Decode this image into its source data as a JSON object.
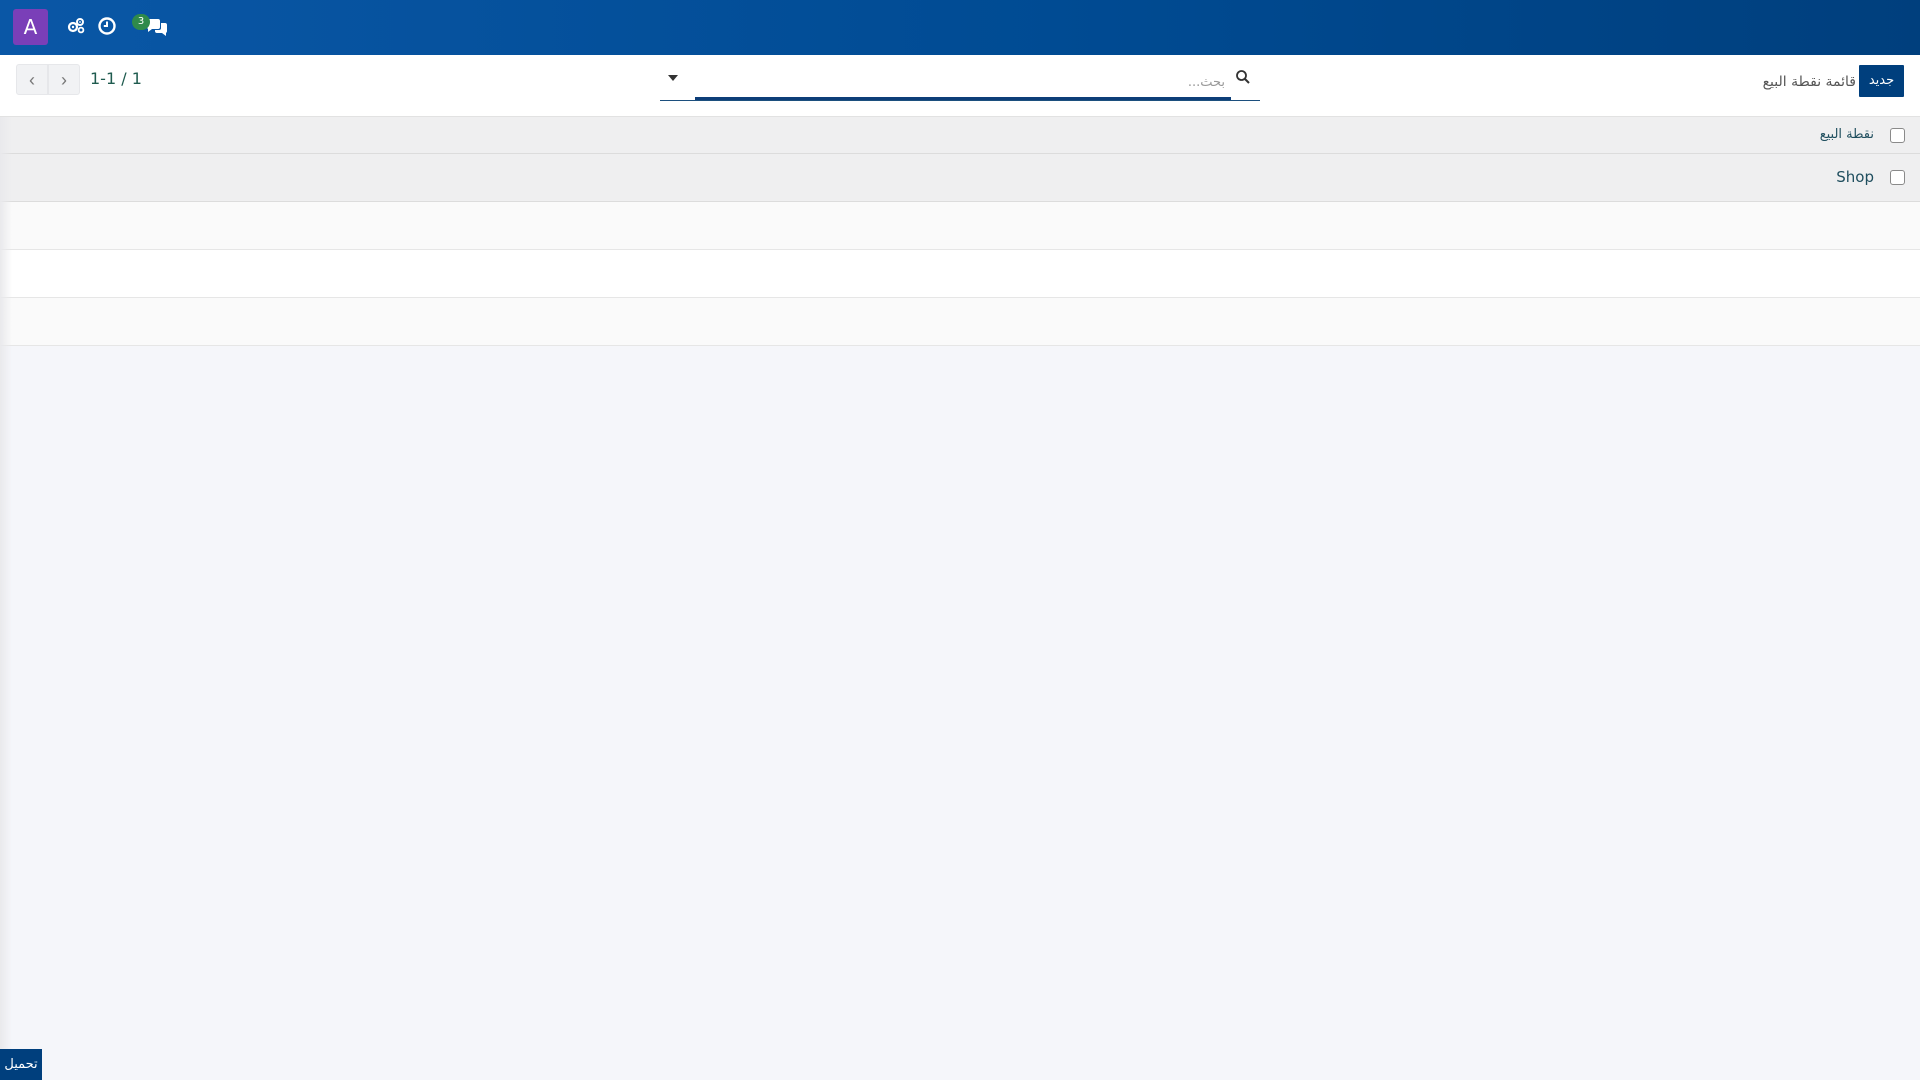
{
  "navbar": {
    "avatar_letter": "A",
    "icons": [
      "gear-icon",
      "clock-icon",
      "chat-icon"
    ],
    "chat_badge_count": "3"
  },
  "control_panel": {
    "new_button_label": "جديد",
    "breadcrumb_title": "قائمة نقطة البيع",
    "search_placeholder": "بحث...",
    "pager_value": "1-1 / 1",
    "pager_prev": "‹",
    "pager_next": "›"
  },
  "list": {
    "rows": [
      {
        "label": "نقطة البيع"
      },
      {
        "label": "Shop"
      }
    ]
  },
  "footer": {
    "load_button_label": "تحميل"
  },
  "colors": {
    "navbar": "#004b93",
    "primary": "#003f7d",
    "avatar": "#7a3fb8",
    "badge": "#2f8a4b"
  }
}
